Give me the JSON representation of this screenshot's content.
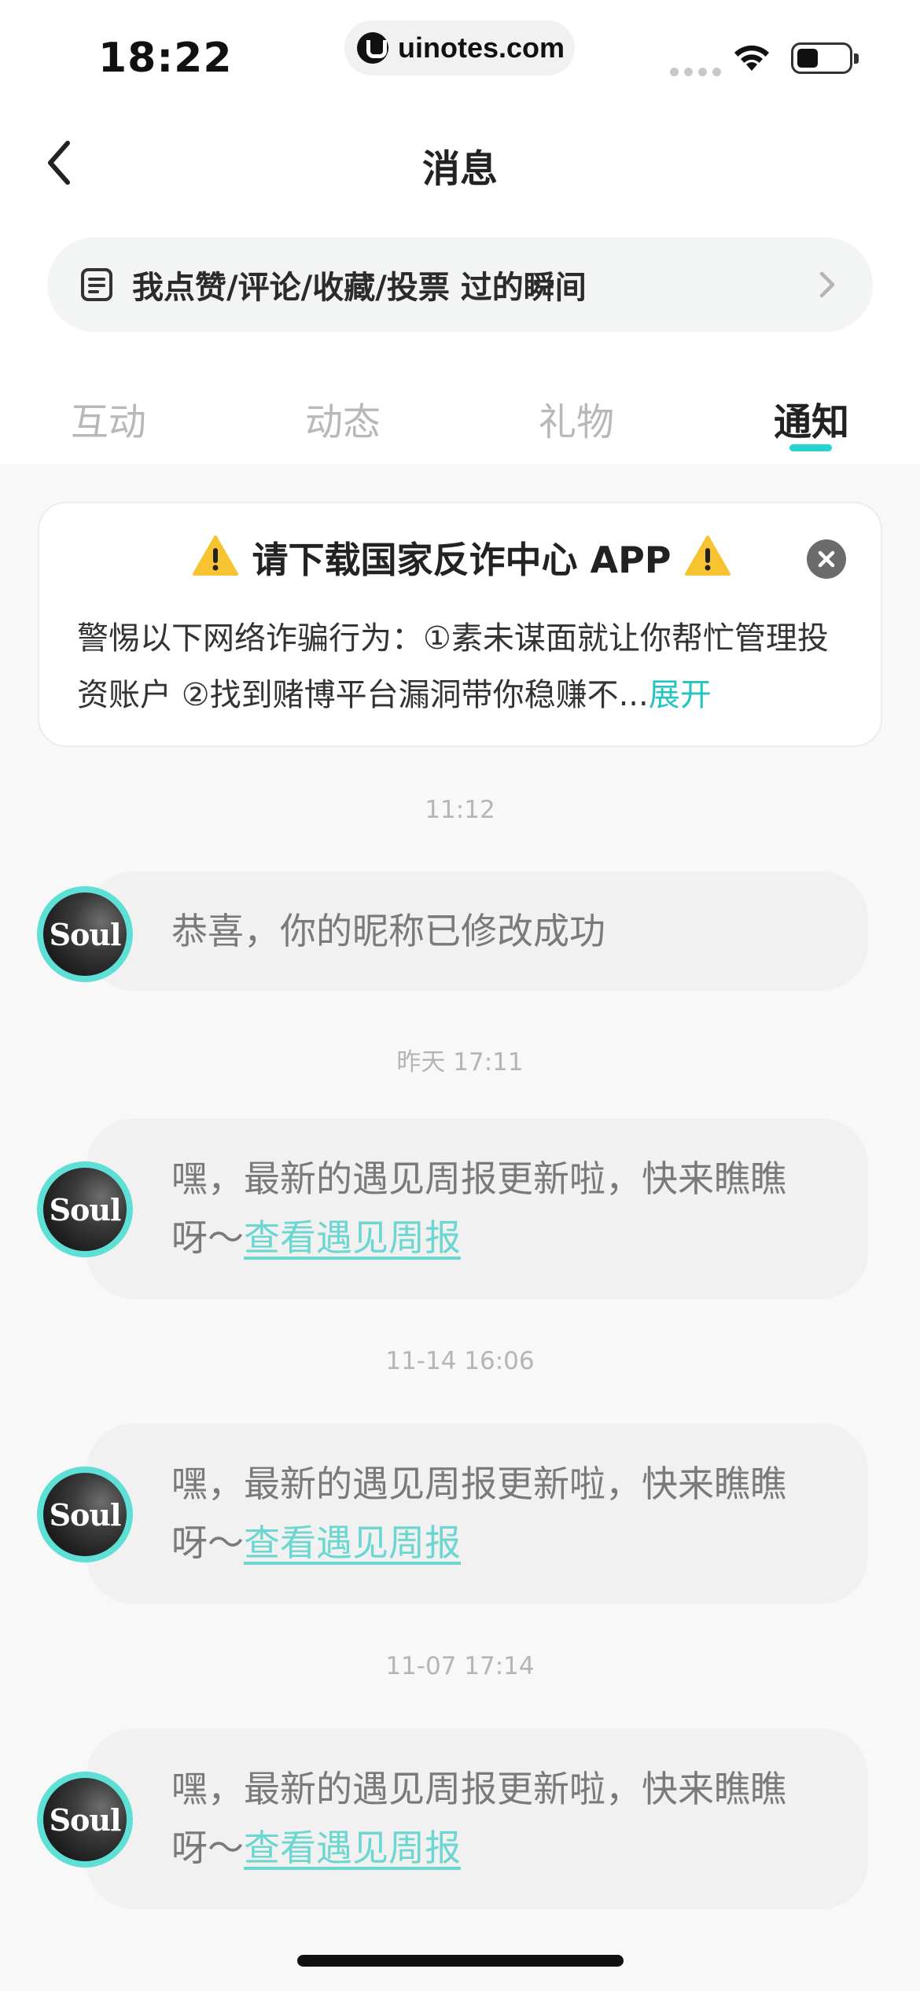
{
  "status_bar": {
    "time": "18:22",
    "url": "uinotes.com",
    "icons": [
      "signal-dots-icon",
      "wifi-icon",
      "battery-icon"
    ]
  },
  "header": {
    "title": "消息",
    "back_icon": "chevron-left-icon"
  },
  "moments_banner": {
    "icon": "document-icon",
    "label": "我点赞/评论/收藏/投票 过的瞬间",
    "chevron_icon": "chevron-right-icon"
  },
  "tabs": [
    {
      "label": "互动",
      "active": false
    },
    {
      "label": "动态",
      "active": false
    },
    {
      "label": "礼物",
      "active": false
    },
    {
      "label": "通知",
      "active": true
    }
  ],
  "notice": {
    "title": "请下载国家反诈中心 APP",
    "warning_icon": "warning-icon",
    "close_icon": "close-icon",
    "body": "警惕以下网络诈骗行为：①素未谋面就让你帮忙管理投资账户 ②找到赌博平台漏洞带你稳赚不...",
    "expand_label": "展开"
  },
  "messages": [
    {
      "timestamp": "11:12",
      "avatar_text": "Soul",
      "text": "恭喜，你的昵称已修改成功",
      "link": ""
    },
    {
      "timestamp": "昨天 17:11",
      "avatar_text": "Soul",
      "text": "嘿，最新的遇见周报更新啦，快来瞧瞧呀～",
      "link": "查看遇见周报"
    },
    {
      "timestamp": "11-14 16:06",
      "avatar_text": "Soul",
      "text": "嘿，最新的遇见周报更新啦，快来瞧瞧呀～",
      "link": "查看遇见周报"
    },
    {
      "timestamp": "11-07 17:14",
      "avatar_text": "Soul",
      "text": "嘿，最新的遇见周报更新啦，快来瞧瞧呀～",
      "link": "查看遇见周报"
    }
  ],
  "colors": {
    "accent": "#25d4d0",
    "link": "#6cd6d0",
    "avatar_ring": "#5ee0d6",
    "background": "#f8f8f8"
  }
}
